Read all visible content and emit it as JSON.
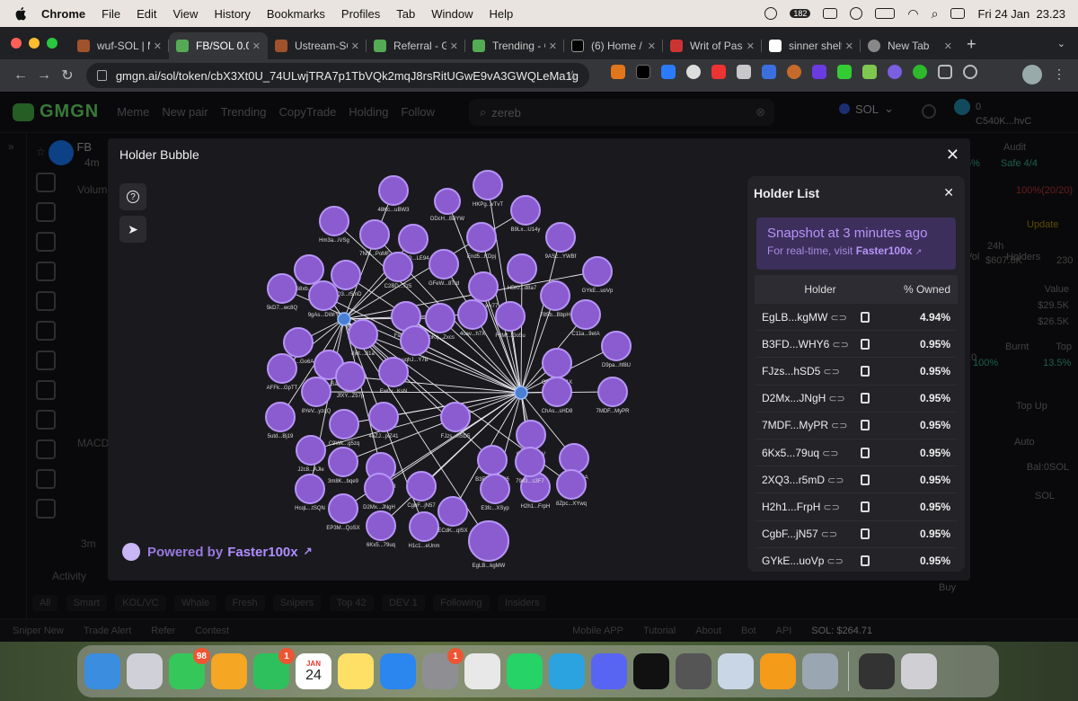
{
  "menubar": {
    "items": [
      "Chrome",
      "File",
      "Edit",
      "View",
      "History",
      "Bookmarks",
      "Profiles",
      "Tab",
      "Window",
      "Help"
    ],
    "notification_count": "182",
    "datetime": "Fri 24 Jan  23.23"
  },
  "browser": {
    "tabs": [
      {
        "title": "wuf-SOL | M",
        "color": "#a0522d"
      },
      {
        "title": "FB/SOL 0.00",
        "color": "#5a5"
      },
      {
        "title": "Ustream-SO",
        "color": "#a0522d"
      },
      {
        "title": "Referral - G",
        "color": "#5a5"
      },
      {
        "title": "Trending - G",
        "color": "#5a5"
      },
      {
        "title": "(6) Home / X",
        "color": "#000000"
      },
      {
        "title": "Writ of Pass",
        "color": "#c33"
      },
      {
        "title": "sinner shelt",
        "color": "#ffffff"
      },
      {
        "title": "New Tab",
        "color": "#888888"
      }
    ],
    "active_tab": 1,
    "url": "gmgn.ai/sol/token/cbX3Xt0U_74ULwjTRA7p1TbVQk2mqJ8rsRitUGwE9vA3GWQLeMa1g"
  },
  "gmgn": {
    "logo": "GMGN",
    "nav": [
      "Meme",
      "New pair",
      "Trending",
      "CopyTrade",
      "Holding",
      "Follow"
    ],
    "search_value": "zereb",
    "chain": "SOL",
    "wallet_balance": "0",
    "wallet_addr": "C540K...hvC",
    "token": "FB",
    "token_age": "4m",
    "bg_labels": {
      "volume": "Volume",
      "macd": "MACD",
      "interval": "3m",
      "activity": "Activity",
      "audit": "Audit",
      "safe": "Safe",
      "safe_count": "4/4",
      "top10": "Top 10",
      "pct": "5%",
      "count_ratio": "100%(20/20)",
      "update": "Update",
      "vol24": "24h Vol",
      "vol24_val": "$607.6K",
      "holders": "Holders",
      "holders_val": "230",
      "value": "Value",
      "v1": "$29.5K",
      "v2": "$26.5K",
      "burnt": "Burnt",
      "burnt_val": "100%",
      "top10b": "Top 10",
      "top10b_val": "13.5%",
      "topup": "Top Up",
      "auto": "Auto",
      "bal": "Bal:0SOL",
      "sol": "SOL",
      "buy": "Buy"
    },
    "bottom_tabs": [
      "All",
      "Smart",
      "KOL/VC",
      "Whale",
      "Fresh",
      "Snipers",
      "Top 42",
      "DEV 1",
      "Following",
      "Insiders"
    ],
    "status": [
      "Sniper New",
      "Trade Alert",
      "Refer",
      "Contest",
      "Mobile APP",
      "Tutorial",
      "About",
      "Bot",
      "API",
      "SOL: $264.71"
    ]
  },
  "modal": {
    "title": "Holder Bubble",
    "powered_prefix": "Powered by",
    "powered_brand": "Faster100x",
    "bubble_labels": [
      "48Kc...uBW3",
      "HKPg...vTvT",
      "DDcH...B8YW",
      "B9Lx...U14y",
      "Hm3a...iVSg",
      "7Nf6...PoMF",
      "8MkQ...LE94",
      "End5...KDpj",
      "9ASc...YWBf",
      "68xb...tBf9",
      "GFeW...8Trd",
      "HBKr...d8a7",
      "GYkE...uoVp",
      "5kD7...wc8Q",
      "2XQ3...r5mD",
      "C2BD...7z5",
      "Fo4a...wv77",
      "9gAs...DWrY",
      "4oav...h7X",
      "785b...BbpH",
      "C11a...9etA",
      "3h5R...Go6A",
      "8j6t...Ji1a",
      "FiaF...n58",
      "9bKq...Zxcs",
      "F6Mt...Go5u",
      "D9pa...hf8U",
      "GU6f...Sagu",
      "uqhJ...Y7B",
      "GUpF...a51X",
      "AFFk...GpTT",
      "JfXY...Z57p",
      "8YeV...yzqQ",
      "Ew0v...KsN",
      "7MDF...MyPR",
      "ChAs...sHD8",
      "5utd...Bj19",
      "C9Wk...g5zq",
      "4oZJ...jxZ41",
      "FJzs...hSD5",
      "CpHy...iwoV",
      "J2c8...AJle",
      "B3FD...WHY6",
      "4Cce...qhtA",
      "3m8K...bqe9",
      "8R2V...tQqR",
      "H2h1...FrpH",
      "7943...s3F7",
      "HcqL...tSQN",
      "D2Mx...JNgH",
      "CgbF...jN57",
      "8Zpc...XYwq",
      "EP3M...QoSX",
      "6Kx5...79uq",
      "H1c1...eUnm",
      "ECdK...qlSX",
      "E3fc...XSyp",
      "EgLB...kgMW"
    ],
    "holder_list": {
      "title": "Holder List",
      "snapshot_title": "Snapshot at 3 minutes ago",
      "snapshot_sub": "For real-time, visit",
      "snapshot_link": "Faster100x",
      "col_holder": "Holder",
      "col_owned": "% Owned",
      "rows": [
        {
          "addr": "EgLB...kgMW",
          "pct": "4.94%"
        },
        {
          "addr": "B3FD...WHY6",
          "pct": "0.95%"
        },
        {
          "addr": "FJzs...hSD5",
          "pct": "0.95%"
        },
        {
          "addr": "D2Mx...JNgH",
          "pct": "0.95%"
        },
        {
          "addr": "7MDF...MyPR",
          "pct": "0.95%"
        },
        {
          "addr": "6Kx5...79uq",
          "pct": "0.95%"
        },
        {
          "addr": "2XQ3...r5mD",
          "pct": "0.95%"
        },
        {
          "addr": "H2h1...FrpH",
          "pct": "0.95%"
        },
        {
          "addr": "CgbF...jN57",
          "pct": "0.95%"
        },
        {
          "addr": "GYkE...uoVp",
          "pct": "0.95%"
        }
      ]
    }
  },
  "dock": {
    "apps": [
      {
        "name": "finder-icon",
        "color": "#3b8de0"
      },
      {
        "name": "launchpad-icon",
        "color": "#d0d0d8"
      },
      {
        "name": "messages-icon",
        "color": "#35c759",
        "badge": "98"
      },
      {
        "name": "photos-icon",
        "color": "#f5a623"
      },
      {
        "name": "facetime-icon",
        "color": "#2ec05c",
        "badge": "1"
      },
      {
        "name": "calendar-icon",
        "color": "#ffffff",
        "label": "24"
      },
      {
        "name": "notes-icon",
        "color": "#ffe066"
      },
      {
        "name": "app-store-icon",
        "color": "#2b86f0"
      },
      {
        "name": "system-settings-icon",
        "color": "#8e8e93",
        "badge": "1"
      },
      {
        "name": "chrome-icon",
        "color": "#e8e8e8"
      },
      {
        "name": "whatsapp-icon",
        "color": "#25d366"
      },
      {
        "name": "telegram-icon",
        "color": "#2aa3e0"
      },
      {
        "name": "discord-icon",
        "color": "#5865f2"
      },
      {
        "name": "chatgpt-icon",
        "color": "#111111"
      },
      {
        "name": "calculator-icon",
        "color": "#555555"
      },
      {
        "name": "preview-icon",
        "color": "#c9d6e6"
      },
      {
        "name": "pages-icon",
        "color": "#f59b1a"
      },
      {
        "name": "iphone-mirroring-icon",
        "color": "#9aa6b2"
      },
      {
        "name": "downloads-icon",
        "color": "#333333"
      },
      {
        "name": "trash-icon",
        "color": "#cfcfd4"
      }
    ],
    "calendar_month": "JAN"
  }
}
